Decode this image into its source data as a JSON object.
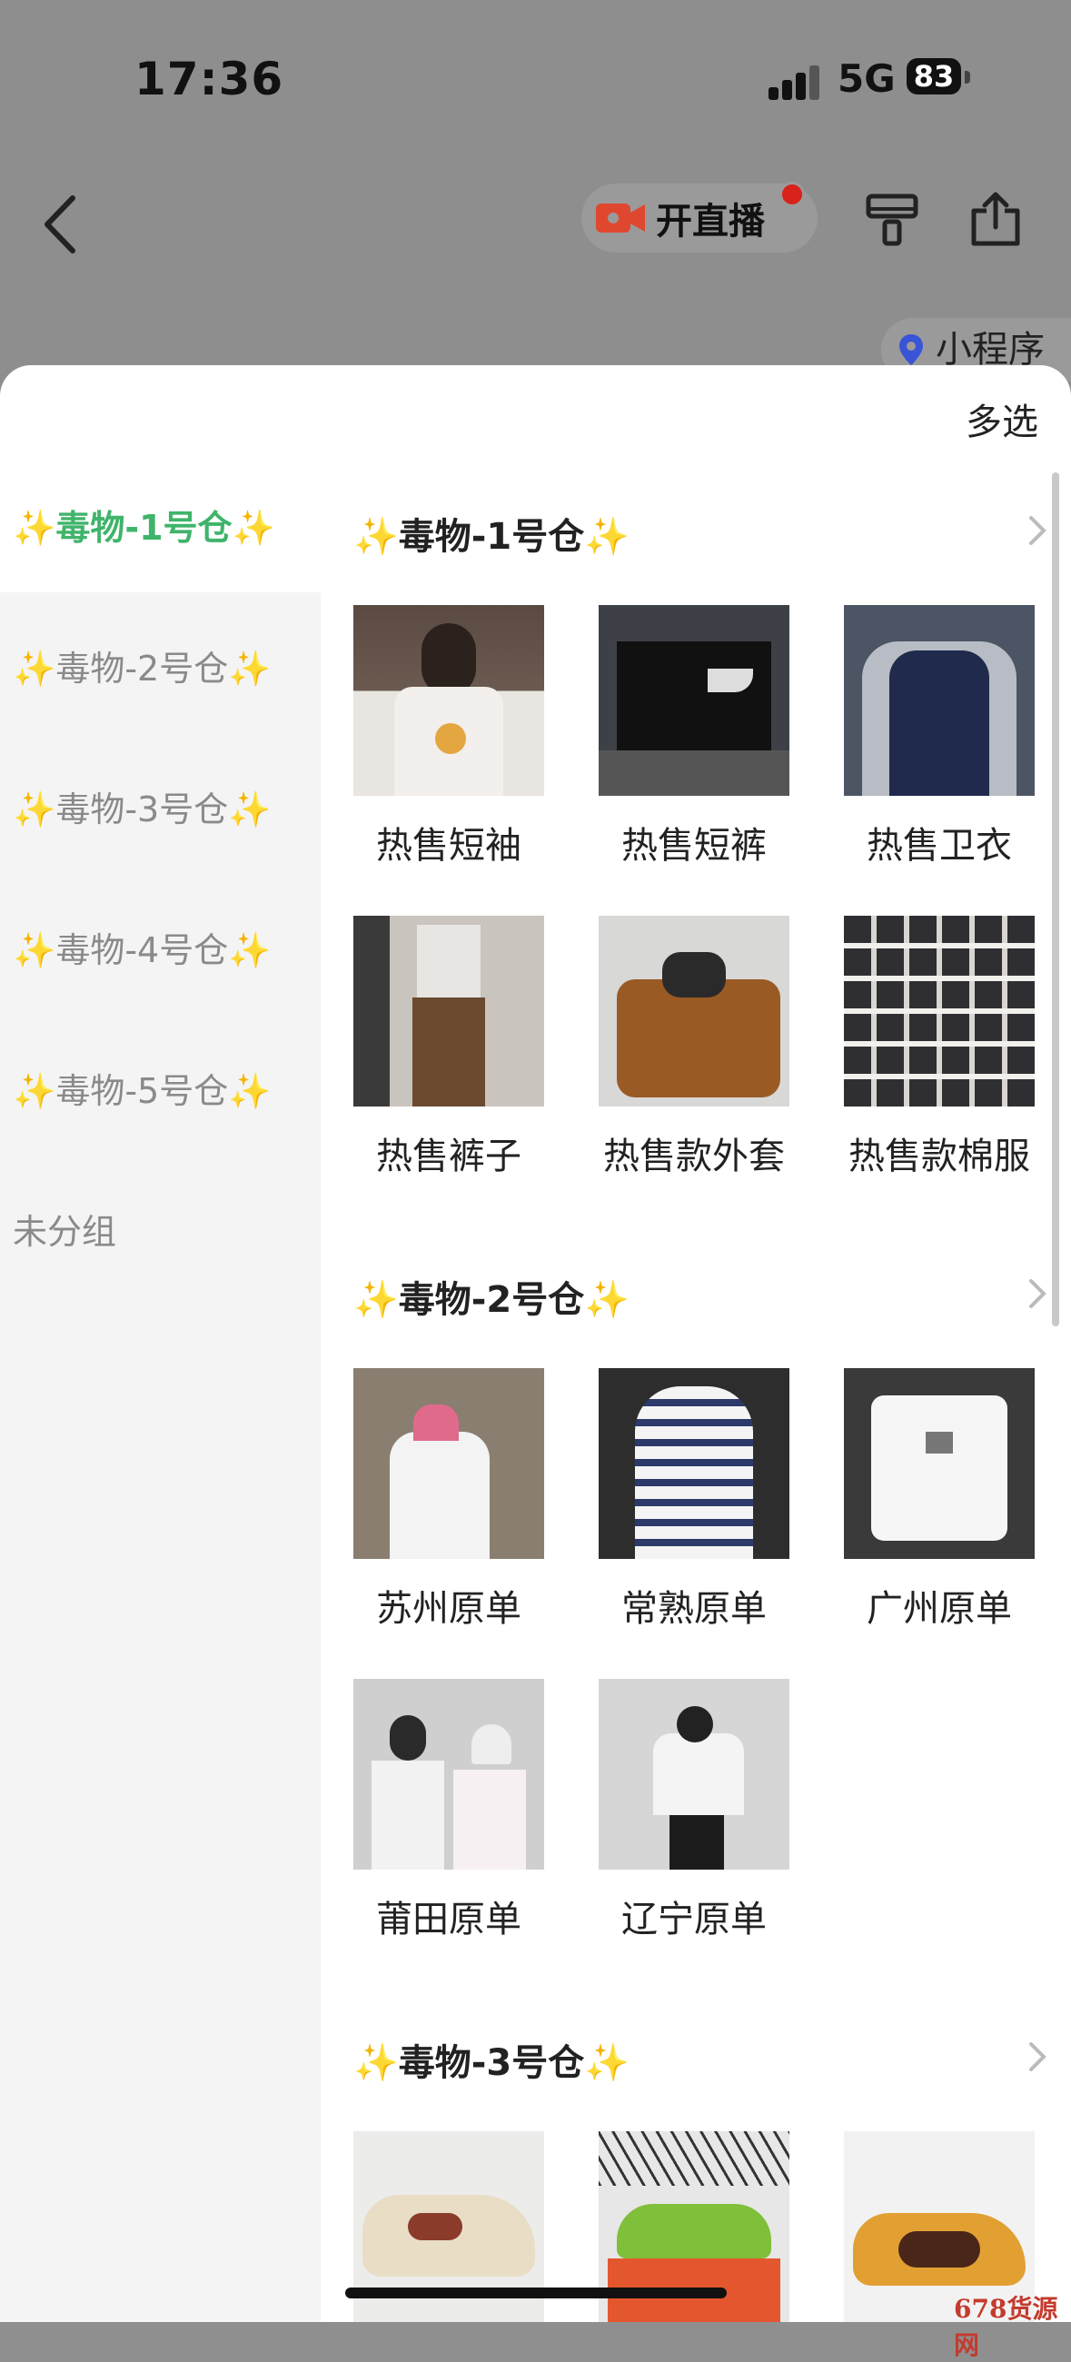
{
  "status_bar": {
    "time": "17:36",
    "network": "5G",
    "battery": "83"
  },
  "nav": {
    "live_label": "开直播",
    "mini_program_label": "小程序",
    "icons": [
      "back-icon",
      "video-camera-icon",
      "paint-roller-icon",
      "share-icon"
    ]
  },
  "sheet": {
    "multi_select_label": "多选",
    "sidebar": [
      {
        "label": "✨毒物-1号仓✨",
        "active": true
      },
      {
        "label": "✨毒物-2号仓✨",
        "active": false
      },
      {
        "label": "✨毒物-3号仓✨",
        "active": false
      },
      {
        "label": "✨毒物-4号仓✨",
        "active": false
      },
      {
        "label": "✨毒物-5号仓✨",
        "active": false
      },
      {
        "label": "未分组",
        "active": false
      }
    ],
    "sections": [
      {
        "title": "✨毒物-1号仓✨",
        "items": [
          "热售短袖",
          "热售短裤",
          "热售卫衣",
          "热售裤子",
          "热售款外套",
          "热售款棉服"
        ]
      },
      {
        "title": "✨毒物-2号仓✨",
        "items": [
          "苏州原单",
          "常熟原单",
          "广州原单",
          "莆田原单",
          "辽宁原单"
        ]
      },
      {
        "title": "✨毒物-3号仓✨",
        "items": [
          "",
          "",
          ""
        ]
      }
    ]
  },
  "watermark": "678货源网",
  "colors": {
    "accent_green": "#3fb46a",
    "live_red": "#d8221a",
    "sidebar_bg": "#f4f4f4"
  }
}
